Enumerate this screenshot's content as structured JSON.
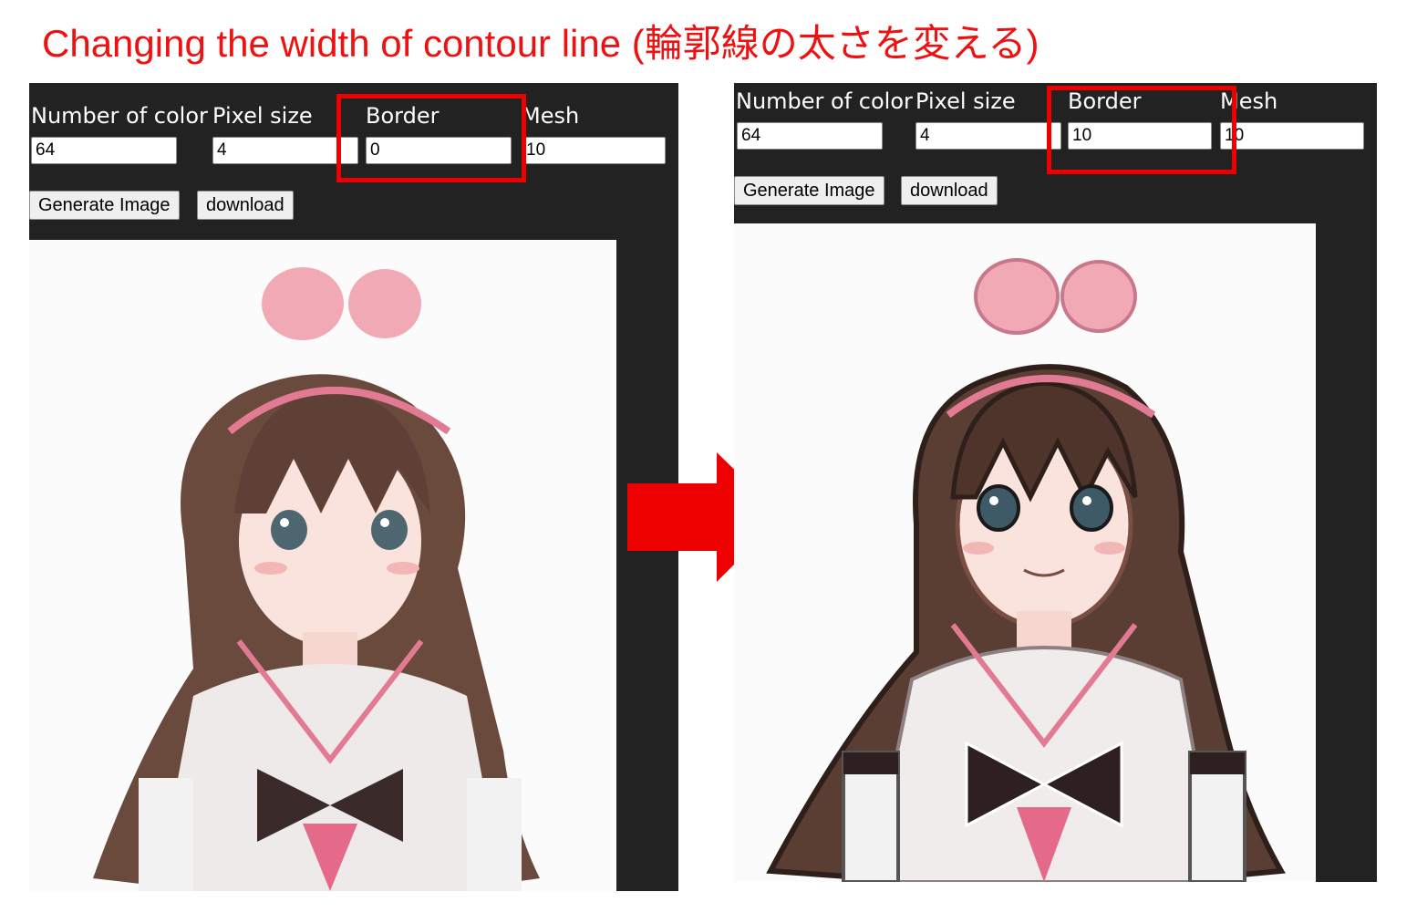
{
  "title": "Changing the width of contour line (輪郭線の太さを変える)",
  "colors": {
    "accent": "#ee1111",
    "panel": "#222222",
    "highlight": "#ee0000"
  },
  "before": {
    "labels": {
      "colors": "Number of color",
      "pixel": "Pixel size",
      "border": "Border",
      "mesh": "Mesh"
    },
    "values": {
      "colors": "64",
      "pixel": "4",
      "border": "0",
      "mesh": "10"
    },
    "buttons": {
      "generate": "Generate Image",
      "download": "download"
    }
  },
  "after": {
    "labels": {
      "colors": "Number of color",
      "pixel": "Pixel size",
      "border": "Border",
      "mesh": "Mesh"
    },
    "values": {
      "colors": "64",
      "pixel": "4",
      "border": "10",
      "mesh": "10"
    },
    "buttons": {
      "generate": "Generate Image",
      "download": "download"
    }
  },
  "icons": {
    "arrow": "right-arrow-icon"
  }
}
